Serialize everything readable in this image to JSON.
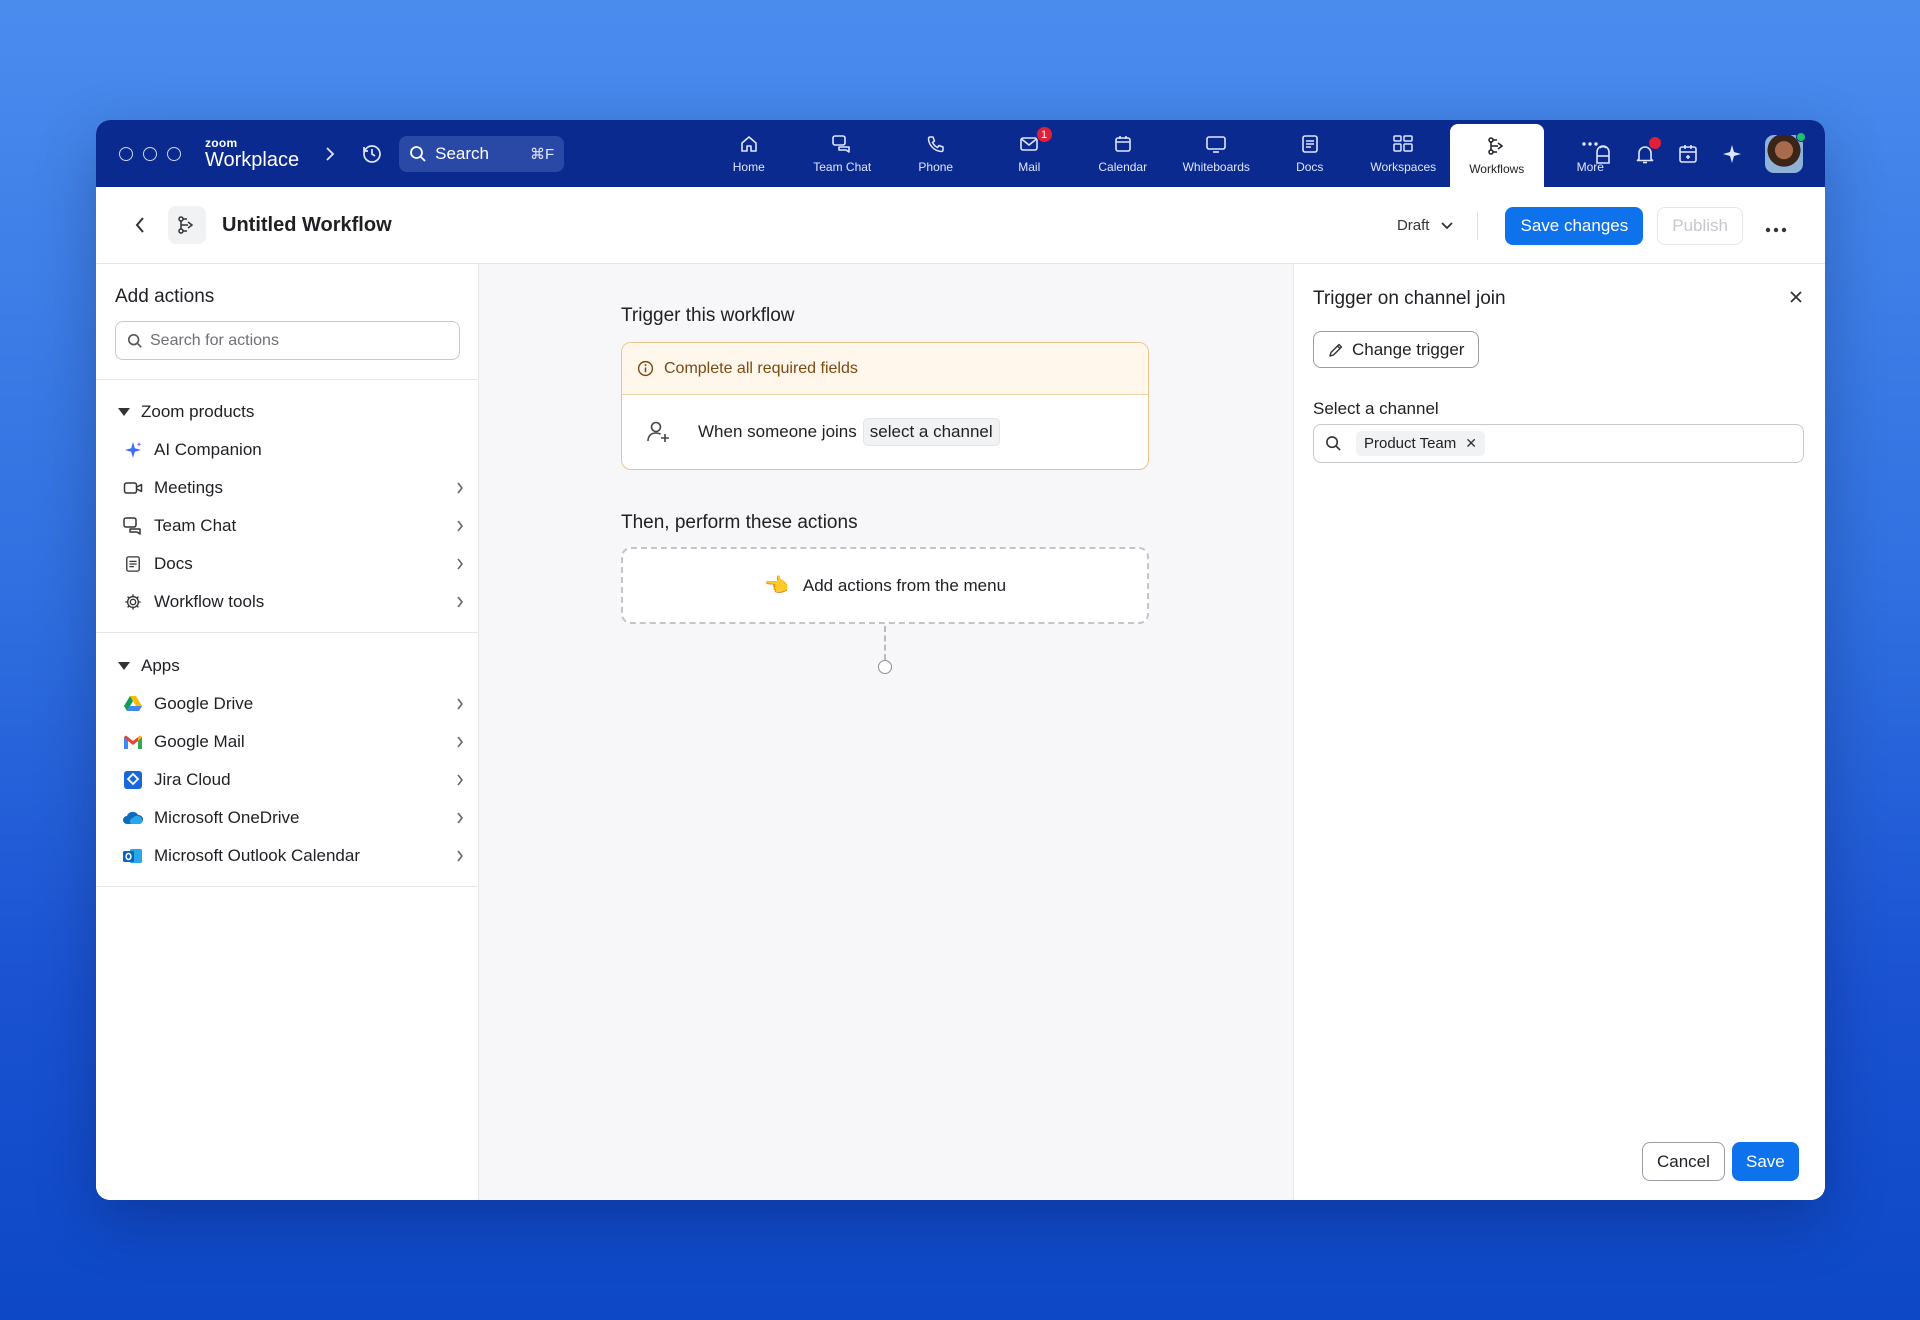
{
  "topbar": {
    "brand_small": "zoom",
    "brand_big": "Workplace",
    "search_label": "Search",
    "search_shortcut": "⌘F",
    "tabs": [
      {
        "label": "Home",
        "icon": "home-icon"
      },
      {
        "label": "Team Chat",
        "icon": "chat-icon"
      },
      {
        "label": "Phone",
        "icon": "phone-icon"
      },
      {
        "label": "Mail",
        "icon": "mail-icon",
        "badge": "1"
      },
      {
        "label": "Calendar",
        "icon": "calendar-icon"
      },
      {
        "label": "Whiteboards",
        "icon": "whiteboard-icon"
      },
      {
        "label": "Docs",
        "icon": "docs-icon"
      },
      {
        "label": "Workspaces",
        "icon": "workspaces-icon"
      },
      {
        "label": "Workflows",
        "icon": "workflow-icon",
        "active": true
      },
      {
        "label": "More",
        "icon": "more-icon"
      }
    ]
  },
  "header": {
    "title": "Untitled Workflow",
    "status": "Draft",
    "save_changes": "Save changes",
    "publish": "Publish"
  },
  "left": {
    "title": "Add actions",
    "search_placeholder": "Search for actions",
    "sections": [
      {
        "title": "Zoom products",
        "items": [
          {
            "label": "AI Companion",
            "icon": "ai-companion-icon",
            "chevron": false
          },
          {
            "label": "Meetings",
            "icon": "video-camera-icon",
            "chevron": true
          },
          {
            "label": "Team Chat",
            "icon": "chat-icon",
            "chevron": true
          },
          {
            "label": "Docs",
            "icon": "docs-icon",
            "chevron": true
          },
          {
            "label": "Workflow tools",
            "icon": "gear-icon",
            "chevron": true
          }
        ]
      },
      {
        "title": "Apps",
        "items": [
          {
            "label": "Google Drive",
            "icon": "google-drive-icon",
            "chevron": true
          },
          {
            "label": "Google Mail",
            "icon": "gmail-icon",
            "chevron": true
          },
          {
            "label": "Jira Cloud",
            "icon": "jira-icon",
            "chevron": true
          },
          {
            "label": "Microsoft OneDrive",
            "icon": "onedrive-icon",
            "chevron": true
          },
          {
            "label": "Microsoft Outlook Calendar",
            "icon": "outlook-icon",
            "chevron": true
          }
        ]
      }
    ]
  },
  "canvas": {
    "trigger_heading": "Trigger this workflow",
    "warning": "Complete all required fields",
    "trigger_text": "When someone joins",
    "trigger_placeholder": "select a channel",
    "actions_heading": "Then, perform these actions",
    "add_actions": "Add actions from the menu"
  },
  "right": {
    "title": "Trigger on channel join",
    "change_trigger": "Change trigger",
    "select_label": "Select a channel",
    "selected_channel": "Product Team",
    "cancel": "Cancel",
    "save": "Save"
  },
  "colors": {
    "accent": "#0e72ed",
    "topbar": "#0b2a8f",
    "warning_bg": "#fff6ec",
    "warning_border": "#e9c48a"
  }
}
